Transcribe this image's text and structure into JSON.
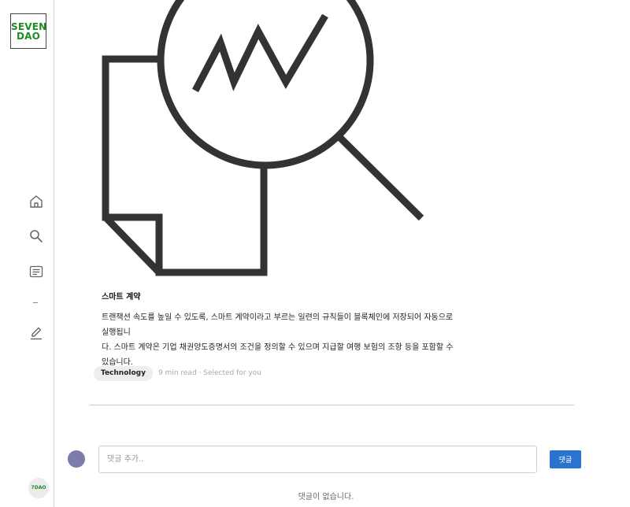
{
  "sidebar": {
    "logo_line1": "SEVEN",
    "logo_line2": "DAO",
    "items": [
      {
        "name": "home",
        "icon": "home-icon"
      },
      {
        "name": "search",
        "icon": "search-icon"
      },
      {
        "name": "articles",
        "icon": "article-icon"
      },
      {
        "name": "write",
        "icon": "pencil-icon"
      }
    ],
    "user_avatar_text": "7DAO"
  },
  "colors": {
    "brand": "#1f8b23",
    "accent": "#2a74cf",
    "illustration": "#333333",
    "commenter_avatar": "#7d7bab"
  },
  "article": {
    "illustration_icon": "document-magnifier-chart-icon",
    "title": "스마트 계약",
    "body_line1": "트랜잭션 속도를 높일 수 있도록, 스마트 계약이라고 부르는 일련의 규칙들이 블록체인에 저장되어 자동으로 실행됩니",
    "body_line2": "다. 스마트 계약은 기업 채권양도증명서의 조건을 정의할 수 있으며 지급할 여행 보험의 조항 등을 포함할 수 있습니다.",
    "tag": "Technology",
    "meta": "9 min read · Selected for you"
  },
  "comments": {
    "placeholder": "댓글 추가..",
    "value": "",
    "submit_label": "댓글",
    "empty_text": "댓글이 없습니다."
  }
}
